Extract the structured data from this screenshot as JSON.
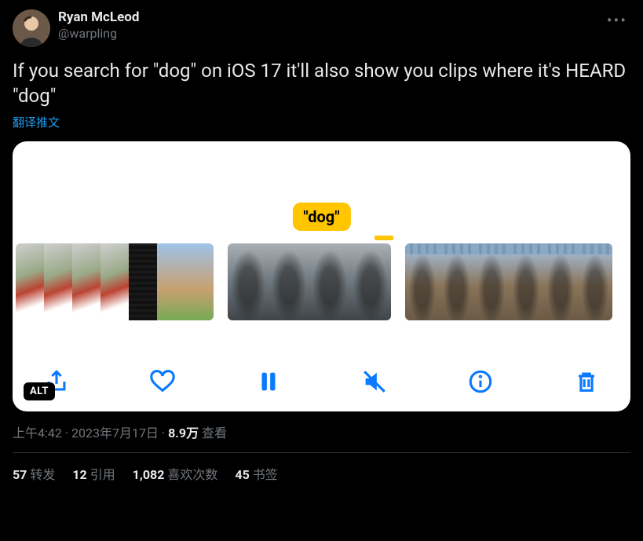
{
  "author": {
    "display_name": "Ryan McLeod",
    "handle": "@warpling"
  },
  "tweet_text": "If you search for \"dog\" on iOS 17 it'll also show you clips where it's HEARD \"dog\"",
  "translate_label": "翻译推文",
  "media": {
    "search_term_label": "\"dog\"",
    "alt_badge": "ALT"
  },
  "timestamp": {
    "time": "上午4:42",
    "date": "2023年7月17日",
    "views_count": "8.9万",
    "views_label": "查看"
  },
  "stats": {
    "retweets_count": "57",
    "retweets_label": "转发",
    "quotes_count": "12",
    "quotes_label": "引用",
    "likes_count": "1,082",
    "likes_label": "喜欢次数",
    "bookmarks_count": "45",
    "bookmarks_label": "书签"
  }
}
